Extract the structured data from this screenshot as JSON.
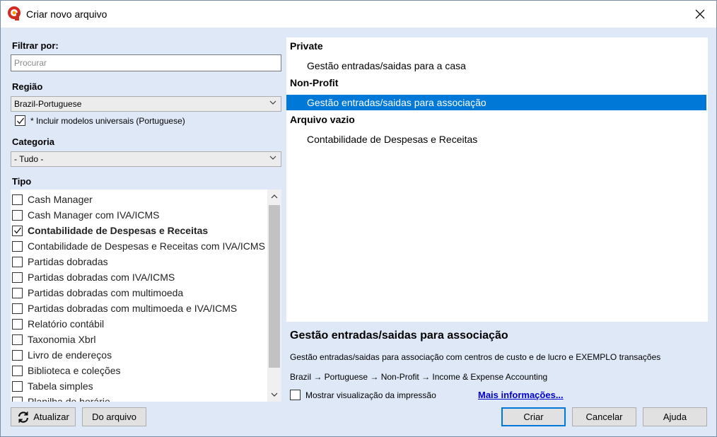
{
  "window": {
    "title": "Criar novo arquivo"
  },
  "filter": {
    "label": "Filtrar por:",
    "placeholder": "Procurar",
    "value": ""
  },
  "region": {
    "label": "Região",
    "selected": "Brazil-Portuguese",
    "include_universal": {
      "label": "* Incluir modelos universais (Portuguese)",
      "checked": true
    }
  },
  "category": {
    "label": "Categoria",
    "selected": "- Tudo -"
  },
  "types": {
    "label": "Tipo",
    "items": [
      {
        "label": "Cash Manager",
        "checked": false
      },
      {
        "label": "Cash Manager com IVA/ICMS",
        "checked": false
      },
      {
        "label": "Contabilidade de Despesas e Receitas",
        "checked": true
      },
      {
        "label": "Contabilidade de Despesas e Receitas com IVA/ICMS",
        "checked": false
      },
      {
        "label": "Partidas dobradas",
        "checked": false
      },
      {
        "label": "Partidas dobradas com IVA/ICMS",
        "checked": false
      },
      {
        "label": "Partidas dobradas com multimoeda",
        "checked": false
      },
      {
        "label": "Partidas dobradas com multimoeda e IVA/ICMS",
        "checked": false
      },
      {
        "label": "Relatório contábil",
        "checked": false
      },
      {
        "label": "Taxonomia Xbrl",
        "checked": false
      },
      {
        "label": "Livro de endereços",
        "checked": false
      },
      {
        "label": "Biblioteca e coleções",
        "checked": false
      },
      {
        "label": "Tabela simples",
        "checked": false
      },
      {
        "label": "Planilha de horário",
        "checked": false
      }
    ]
  },
  "left_buttons": {
    "refresh": "Atualizar",
    "from_file": "Do arquivo"
  },
  "templates": {
    "groups": [
      {
        "title": "Private",
        "items": [
          "Gestão entradas/saidas para a casa"
        ]
      },
      {
        "title": "Non-Profit",
        "items": [
          "Gestão entradas/saidas para associação"
        ]
      },
      {
        "title": "Arquivo vazio",
        "items": [
          "Contabilidade de Despesas e Receitas"
        ]
      }
    ],
    "selected": "Gestão entradas/saidas para associação"
  },
  "detail": {
    "title": "Gestão entradas/saidas para associação",
    "description": "Gestão entradas/saidas para associação com centros de custo e de lucro e EXEMPLO transações",
    "path": "Brazil → Portuguese → Non-Profit → Income & Expense Accounting",
    "print_preview": {
      "label": "Mostrar visualização da impressão",
      "checked": false
    },
    "more_info": "Mais informações..."
  },
  "footer": {
    "create": "Criar",
    "cancel": "Cancelar",
    "help": "Ajuda"
  },
  "colors": {
    "selection": "#0078d7",
    "window_bg": "#dfe8f6",
    "link": "#0000cc",
    "logo_red": "#d42a1f",
    "logo_orange": "#f2a100"
  },
  "icons": {
    "close": "close-icon",
    "refresh": "refresh-icon",
    "dropdown": "chevron-down-icon",
    "checkmark": "checkmark-icon",
    "scroll_up": "chevron-up-icon",
    "scroll_down": "chevron-down-icon"
  }
}
